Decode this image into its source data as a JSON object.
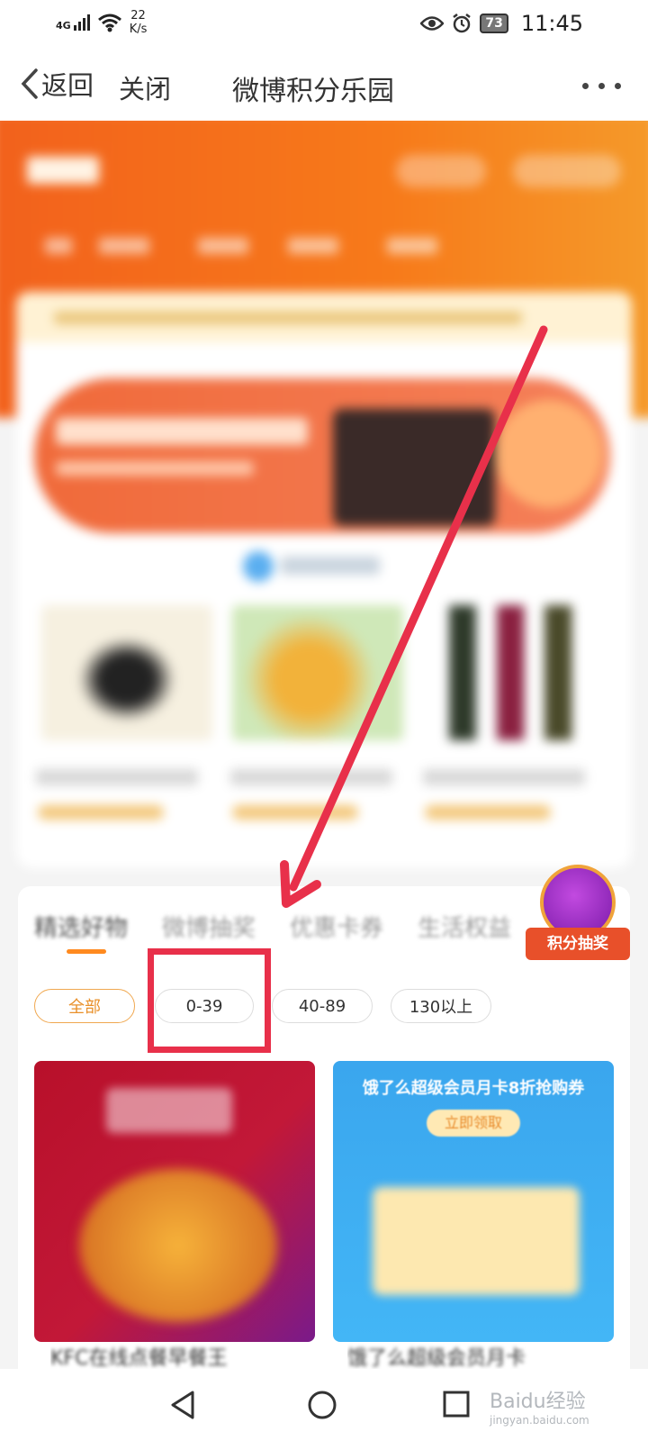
{
  "status_bar": {
    "network": "4G",
    "speed_value": "22",
    "speed_unit": "K/s",
    "battery": "73",
    "time": "11:45",
    "icons": [
      "signal-icon",
      "wifi-icon",
      "eye-icon",
      "alarm-icon",
      "battery-icon"
    ]
  },
  "nav": {
    "back_label": "返回",
    "close_label": "关闭",
    "title": "微博积分乐园"
  },
  "tabs": {
    "items": [
      "精选好物",
      "微博抽奖",
      "优惠卡券",
      "生活权益"
    ],
    "active_index": 0
  },
  "float_badge": {
    "label": "积分抽奖"
  },
  "filters": {
    "chips": [
      "全部",
      "0-39",
      "40-89",
      "130以上"
    ],
    "active_index": 0,
    "highlighted_index": 1
  },
  "cards": [
    {
      "title": "KFC在线点餐早餐王"
    },
    {
      "title": "饿了么超级会员月卡",
      "banner_text": "饿了么超级会员月卡8折抢购券",
      "button_text": "立即领取"
    }
  ],
  "watermark": {
    "brand": "Baidu经验",
    "domain": "jingyan.baidu.com"
  },
  "colors": {
    "accent_orange": "#f47320",
    "annotation_red": "#e8304a",
    "chip_active": "#e9902a"
  }
}
